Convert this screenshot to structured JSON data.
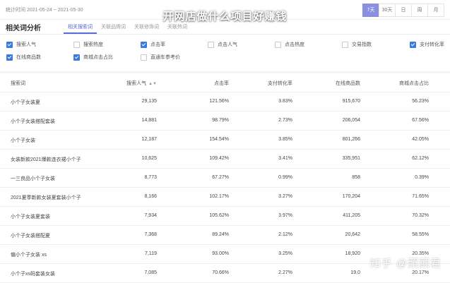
{
  "overlay_title": "开网店做什么项目好赚钱",
  "header": {
    "stat_time": "统计时间 2021-05-24 ~ 2021-05-30",
    "ranges": [
      {
        "label": "7天",
        "active": true
      },
      {
        "label": "30天",
        "active": false
      },
      {
        "label": "日",
        "active": false
      },
      {
        "label": "周",
        "active": false
      },
      {
        "label": "月",
        "active": false
      }
    ]
  },
  "tabbar": {
    "section_title": "相关词分析",
    "tabs": [
      "相关搜索词",
      "关联品牌词",
      "关联修饰词",
      "关联热词"
    ]
  },
  "filters": [
    {
      "label": "搜索人气",
      "checked": true
    },
    {
      "label": "搜索热度",
      "checked": false
    },
    {
      "label": "点击率",
      "checked": true
    },
    {
      "label": "点击人气",
      "checked": false
    },
    {
      "label": "点击热度",
      "checked": false
    },
    {
      "label": "交易指数",
      "checked": false
    },
    {
      "label": "支付转化率",
      "checked": true
    },
    {
      "label": "在线商品数",
      "checked": true
    },
    {
      "label": "商城点击占比",
      "checked": true
    },
    {
      "label": "直通车参考价",
      "checked": false
    }
  ],
  "table": {
    "headers": [
      "搜索词",
      "搜索人气",
      "点击率",
      "支付转化率",
      "在线商品数",
      "商城点击占比"
    ],
    "sort_icon": "sort-icon",
    "rows": [
      [
        "小个子女装夏",
        "29,135",
        "121.56%",
        "3.83%",
        "915,670",
        "56.23%"
      ],
      [
        "小个子女装搭配套装",
        "14,881",
        "98.79%",
        "2.73%",
        "206,054",
        "67.56%"
      ],
      [
        "小个子女装",
        "12,187",
        "154.54%",
        "3.85%",
        "801,266",
        "42.05%"
      ],
      [
        "女装新款2021爆款连衣裙小个子",
        "10,625",
        "109.42%",
        "3.41%",
        "335,951",
        "62.12%"
      ],
      [
        "一三良品小个子女装",
        "8,773",
        "67.27%",
        "0.99%",
        "858",
        "0.39%"
      ],
      [
        "2021夏季新款女装夏套装小个子",
        "8,166",
        "102.17%",
        "3.27%",
        "170,204",
        "71.65%"
      ],
      [
        "小个子女装夏套装",
        "7,934",
        "105.62%",
        "3.97%",
        "411,205",
        "70.32%"
      ],
      [
        "小个子女装搭配夏",
        "7,368",
        "89.24%",
        "2.12%",
        "20,642",
        "58.55%"
      ],
      [
        "偏小个子女装 xs",
        "7,119",
        "93.00%",
        "3.25%",
        "18,920",
        "20.35%"
      ],
      [
        "小个子xs码套装女装",
        "7,085",
        "70.66%",
        "2.27%",
        "19,0",
        "20.17%"
      ]
    ]
  },
  "watermark": "知乎 @照顾君"
}
